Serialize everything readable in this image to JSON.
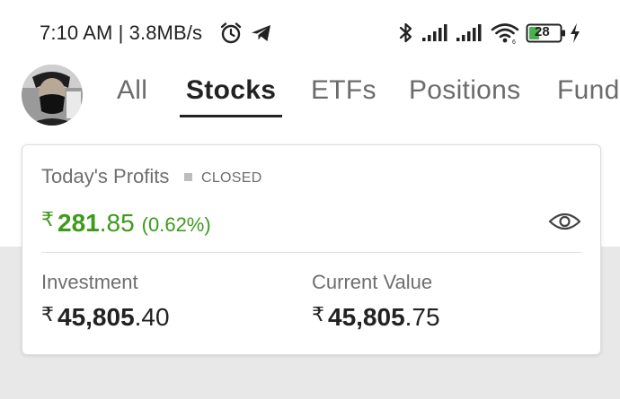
{
  "status_bar": {
    "time": "7:10 AM | 3.8MB/s",
    "battery_level": "28",
    "icons": [
      "alarm-icon",
      "telegram-icon",
      "bluetooth-icon",
      "signal-icon",
      "signal-icon",
      "wifi-icon",
      "battery-icon",
      "charging-icon"
    ]
  },
  "tabs": [
    {
      "label": "All",
      "active": false
    },
    {
      "label": "Stocks",
      "active": true
    },
    {
      "label": "ETFs",
      "active": false
    },
    {
      "label": "Positions",
      "active": false
    },
    {
      "label": "Fund",
      "active": false
    }
  ],
  "card": {
    "title": "Today's Profits",
    "market_status": "CLOSED",
    "currency_symbol": "₹",
    "profit_whole": "281",
    "profit_decimal": ".85",
    "profit_percent": "(0.62%)",
    "investment": {
      "label": "Investment",
      "whole": "45,805",
      "decimal": ".40"
    },
    "current_value": {
      "label": "Current Value",
      "whole": "45,805",
      "decimal": ".75"
    }
  },
  "colors": {
    "profit_green": "#3d9b1c",
    "battery_green": "#4caf50",
    "text_dark": "#222222",
    "text_muted": "#6e6e6e",
    "page_grey": "#e8e8e8"
  }
}
